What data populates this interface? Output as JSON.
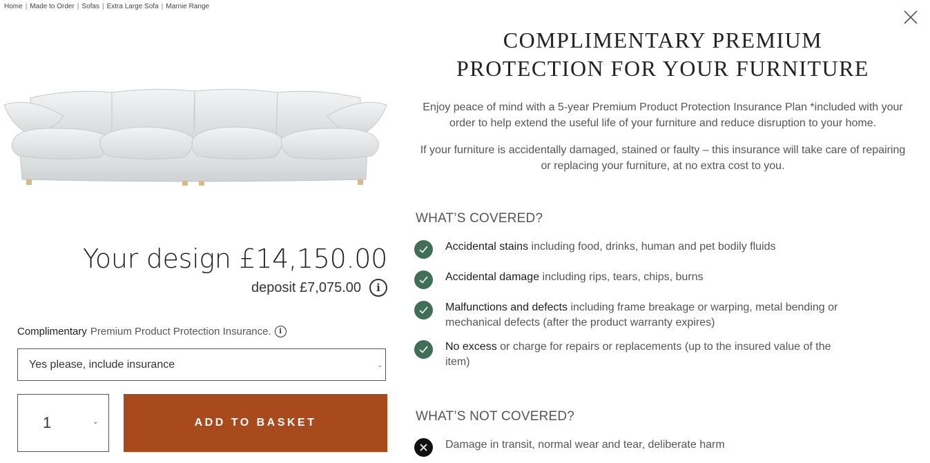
{
  "breadcrumb": [
    "Home",
    "Made to Order",
    "Sofas",
    "Extra Large Sofa",
    "Marnie Range"
  ],
  "product": {
    "price_label": "Your design £14,150.00",
    "deposit_label": "deposit £7,075.00",
    "insurance_label_strong": "Complimentary",
    "insurance_label_rest": "Premium Product Protection Insurance.",
    "insurance_selected": "Yes please, include insurance",
    "quantity": "1",
    "add_to_basket": "ADD TO BASKET"
  },
  "modal": {
    "title_line1": "COMPLIMENTARY PREMIUM",
    "title_line2": "PROTECTION FOR YOUR FURNITURE",
    "intro_1": "Enjoy peace of mind with a 5-year Premium Product Protection Insurance Plan *included with your order to help extend the useful life of your furniture and reduce disruption to your home.",
    "intro_2": "If your furniture is accidentally damaged, stained or faulty – this insurance will take care of repairing or replacing your furniture, at no extra cost to you.",
    "covered_heading": "WHAT’S COVERED?",
    "covered": [
      {
        "strong": "Accidental stains",
        "text": " including food, drinks, human and pet bodily fluids"
      },
      {
        "strong": "Accidental damage",
        "text": " including rips, tears, chips, burns"
      },
      {
        "strong": "Malfunctions and defects",
        "text": " including frame breakage or warping, metal bending or mechanical defects (after the product warranty expires)"
      },
      {
        "strong": "No excess",
        "text": " or charge for repairs or replacements (up to the insured value of the item)"
      }
    ],
    "not_covered_heading": "WHAT’S NOT COVERED?",
    "not_covered": [
      {
        "text": "Damage in transit, normal wear and tear, deliberate harm"
      }
    ]
  },
  "colors": {
    "basket_button": "#a94a1d",
    "check_green": "#3f6f54"
  },
  "icons": {
    "close": "close-icon",
    "info": "info-icon",
    "check": "check-icon",
    "cross": "cross-icon",
    "chevron": "chevron-down-icon"
  }
}
